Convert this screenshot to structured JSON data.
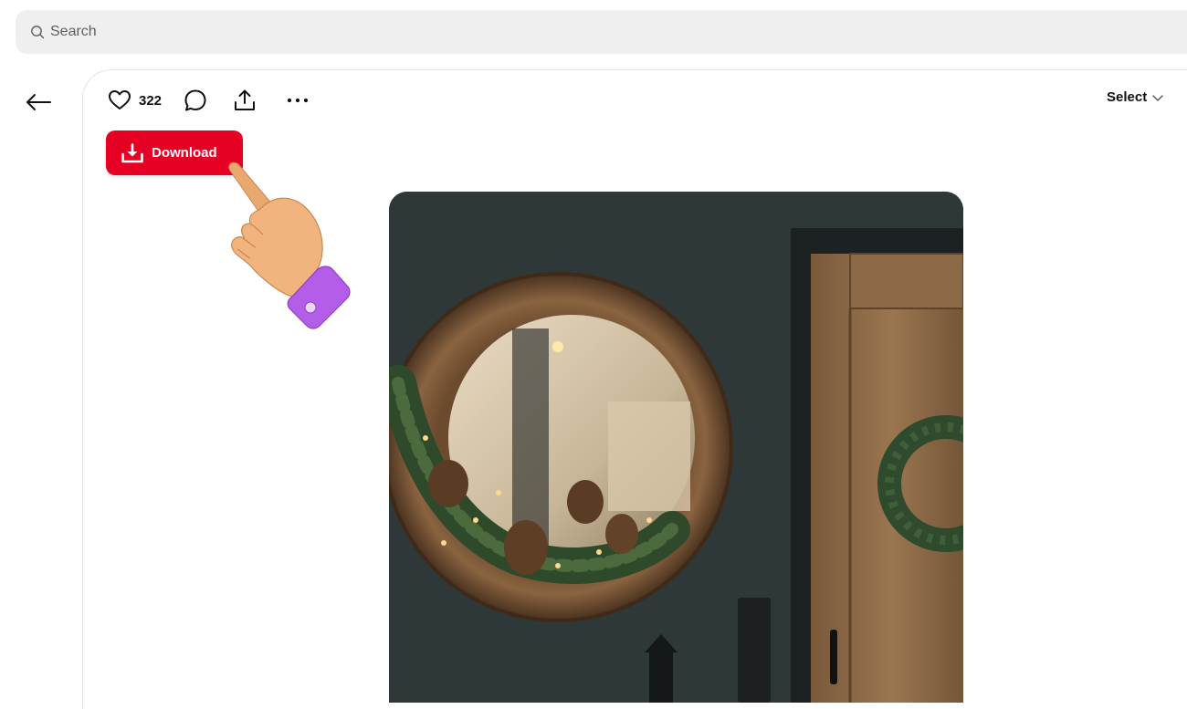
{
  "search": {
    "placeholder": "Search"
  },
  "toolbar": {
    "like_count": "322",
    "select_label": "Select"
  },
  "download": {
    "label": "Download"
  },
  "icons": {
    "search": "search-icon",
    "back": "arrow-left-icon",
    "like": "heart-icon",
    "comment": "comment-icon",
    "share": "share-icon",
    "more": "more-icon",
    "select": "chevron-down-icon",
    "download": "download-icon",
    "pointer": "pointing-hand-icon"
  },
  "colors": {
    "accent": "#e60023",
    "search_bg": "#efefef"
  },
  "pin": {
    "image": "round wooden mirror with pine garland and wreath on dark wall"
  }
}
